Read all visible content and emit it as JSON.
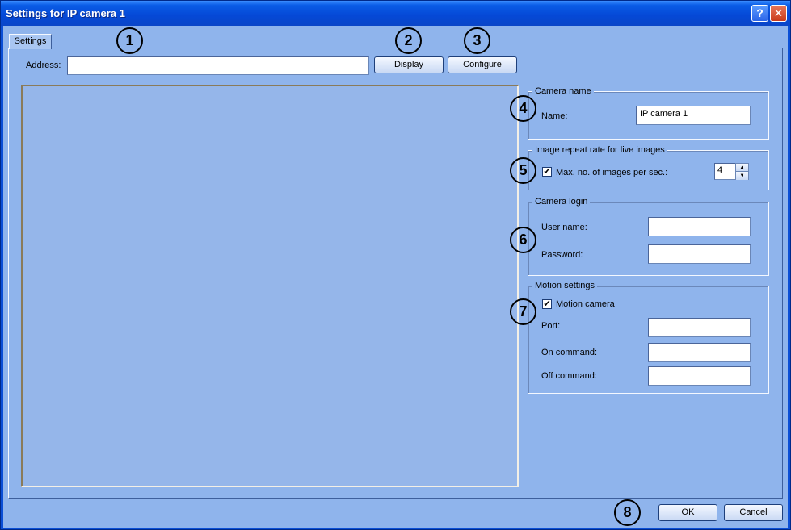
{
  "window": {
    "title": "Settings for IP camera 1",
    "help_glyph": "?",
    "close_glyph": "✕"
  },
  "tab": {
    "label": "Settings"
  },
  "address": {
    "label": "Address:",
    "value": ""
  },
  "buttons": {
    "display": "Display",
    "configure": "Configure",
    "ok": "OK",
    "cancel": "Cancel"
  },
  "camera_name": {
    "title": "Camera name",
    "name_label": "Name:",
    "name_value": "IP camera 1"
  },
  "repeat_rate": {
    "title": "Image repeat rate for live images",
    "checkbox_label": "Max. no. of images per sec.:",
    "checked": true,
    "value": "4"
  },
  "camera_login": {
    "title": "Camera login",
    "user_label": "User name:",
    "user_value": "",
    "password_label": "Password:",
    "password_value": ""
  },
  "motion": {
    "title": "Motion settings",
    "checkbox_label": "Motion camera",
    "checked": true,
    "port_label": "Port:",
    "port_value": "",
    "on_label": "On command:",
    "on_value": "",
    "off_label": "Off command:",
    "off_value": ""
  },
  "badges": [
    "1",
    "2",
    "3",
    "4",
    "5",
    "6",
    "7",
    "8"
  ],
  "icons": {
    "check": "✔",
    "spin_up": "▲",
    "spin_down": "▼"
  }
}
